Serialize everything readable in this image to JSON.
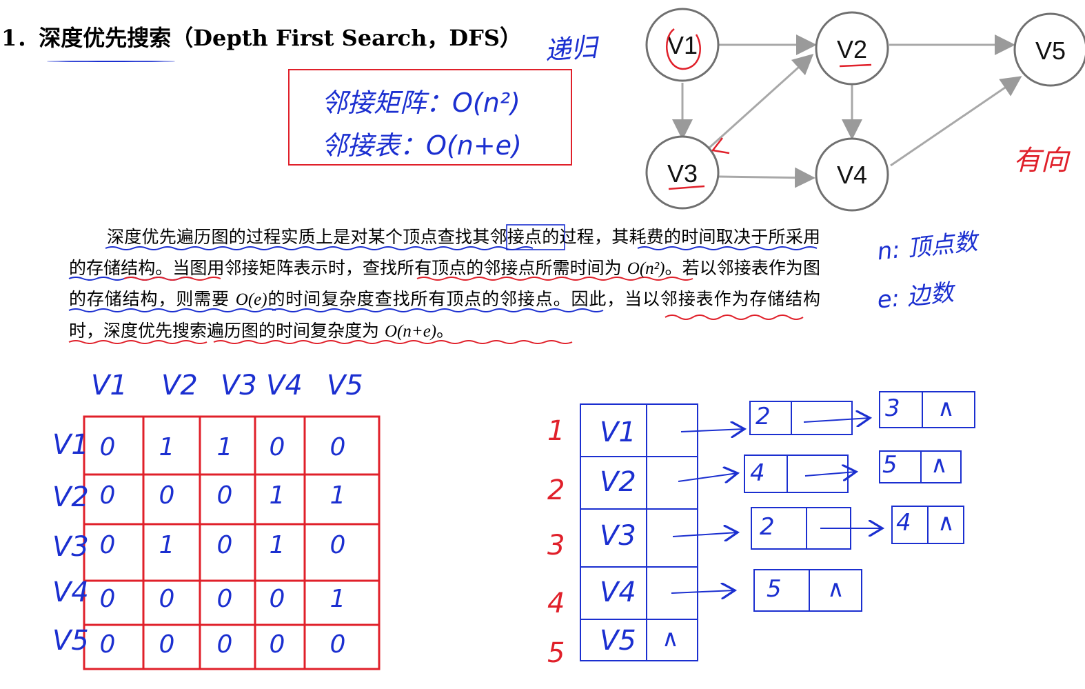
{
  "heading": "1．深度优先搜索（Depth First Search，DFS）",
  "annotations": {
    "recursion": "递归",
    "matrix_complexity": "邻接矩阵：O(n²)",
    "list_complexity": "邻接表：O(n+e)",
    "n_meaning": "n: 顶点数",
    "e_meaning": "e: 边数",
    "directed": "有向"
  },
  "graph": {
    "nodes": [
      "V1",
      "V2",
      "V3",
      "V4",
      "V5"
    ],
    "edges": [
      [
        "V1",
        "V2"
      ],
      [
        "V1",
        "V3"
      ],
      [
        "V2",
        "V5"
      ],
      [
        "V2",
        "V4"
      ],
      [
        "V3",
        "V2"
      ],
      [
        "V3",
        "V4"
      ],
      [
        "V4",
        "V5"
      ]
    ]
  },
  "paragraph": {
    "p1": "深度优先遍历图的过程实质上是对某个顶点查找其邻接点的过程，其耗费的时间取决于所采用的存储结构。当图用邻接矩阵表示时，查找所有顶点的邻接点所需时间为 ",
    "o_n2": "O(n²)",
    "p2": "。若以邻接表作为图的存储结构，则需要 ",
    "o_e": "O(e)",
    "p3": "的时间复杂度查找所有顶点的邻接点。因此，当以邻接表作为存储结构时，深度优先搜索遍历图的时间复杂度为 ",
    "o_ne": "O(n+e)",
    "p4": "。"
  },
  "matrix": {
    "col_headers": [
      "V1",
      "V2",
      "V3",
      "V4",
      "V5"
    ],
    "row_headers": [
      "V1",
      "V2",
      "V3",
      "V4",
      "V5"
    ],
    "rows": [
      [
        "0",
        "1",
        "1",
        "0",
        "0"
      ],
      [
        "0",
        "0",
        "0",
        "1",
        "1"
      ],
      [
        "0",
        "1",
        "0",
        "1",
        "0"
      ],
      [
        "0",
        "0",
        "0",
        "0",
        "1"
      ],
      [
        "0",
        "0",
        "0",
        "0",
        "0"
      ]
    ]
  },
  "adjacency_list": {
    "indices": [
      "1",
      "2",
      "3",
      "4",
      "5"
    ],
    "vertices": [
      "V1",
      "V2",
      "V3",
      "V4",
      "V5"
    ],
    "null_mark": "∧",
    "lists": [
      [
        {
          "adj": "2"
        },
        {
          "adj": "3",
          "end": "∧"
        }
      ],
      [
        {
          "adj": "4"
        },
        {
          "adj": "5",
          "end": "∧"
        }
      ],
      [
        {
          "adj": "2"
        },
        {
          "adj": "4",
          "end": "∧"
        }
      ],
      [
        {
          "adj": "5",
          "end": "∧"
        }
      ],
      []
    ]
  }
}
